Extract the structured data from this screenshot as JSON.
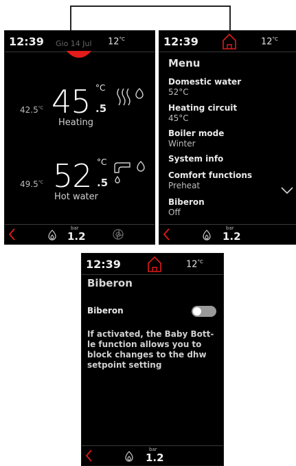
{
  "connector_color": "#222222",
  "accent_color": "#e21b1b",
  "status": {
    "time": "12:39",
    "date": "Gio 14 Jul",
    "outdoor_temp": "12",
    "outdoor_unit": "°C"
  },
  "home_screen": {
    "heating": {
      "setpoint": "45",
      "setpoint_decimal": ".5",
      "unit": "°C",
      "current": "42.5",
      "current_unit": "°C",
      "label": "Heating",
      "icon": "radiator-waves-icon"
    },
    "hot_water": {
      "setpoint": "52",
      "setpoint_decimal": ".5",
      "unit": "°C",
      "current": "49.5",
      "current_unit": "°C",
      "label": "Hot water",
      "icon": "tap-icon"
    }
  },
  "bottom": {
    "pressure_label": "bar",
    "pressure_value": "1.2"
  },
  "menu": {
    "title": "Menu",
    "items": [
      {
        "label": "Domestic water",
        "value": "52°C"
      },
      {
        "label": "Heating circuit",
        "value": "45°C"
      },
      {
        "label": "Boiler mode",
        "value": "Winter"
      },
      {
        "label": "System info",
        "value": ""
      },
      {
        "label": "Comfort functions",
        "value": "Preheat"
      },
      {
        "label": "Biberon",
        "value": "Off"
      }
    ]
  },
  "biberon": {
    "title": "Biberon",
    "option_label": "Biberon",
    "toggle_state": "off",
    "description": "If activated, the Baby Bott-le function allows you to block changes to the dhw setpoint setting"
  }
}
